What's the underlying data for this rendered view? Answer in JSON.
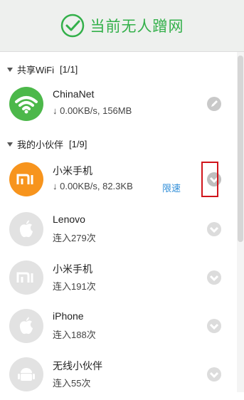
{
  "header": {
    "title": "当前无人蹭网",
    "accent": "#33b04a"
  },
  "sections": [
    {
      "label": "共享WiFi",
      "count": "[1/1]"
    },
    {
      "label": "我的小伙伴",
      "count": "[1/9]"
    }
  ],
  "wifi": {
    "name": "ChinaNet",
    "stats": "↓ 0.00KB/s, 156MB",
    "icon": "wifi-icon",
    "color": "#4cb84a"
  },
  "devices": [
    {
      "name": "小米手机",
      "sub": "↓ 0.00KB/s, 82.3KB",
      "limit": "限速",
      "icon": "mi-logo-icon",
      "active": true,
      "color": "#f7941d"
    },
    {
      "name": "Lenovo",
      "sub": "连入279次",
      "icon": "apple-icon",
      "active": false
    },
    {
      "name": "小米手机",
      "sub": "连入191次",
      "icon": "mi-logo-icon",
      "active": false
    },
    {
      "name": "iPhone",
      "sub": "连入188次",
      "icon": "apple-icon",
      "active": false
    },
    {
      "name": "无线小伙伴",
      "sub": "连入55次",
      "icon": "android-icon",
      "active": false
    }
  ]
}
